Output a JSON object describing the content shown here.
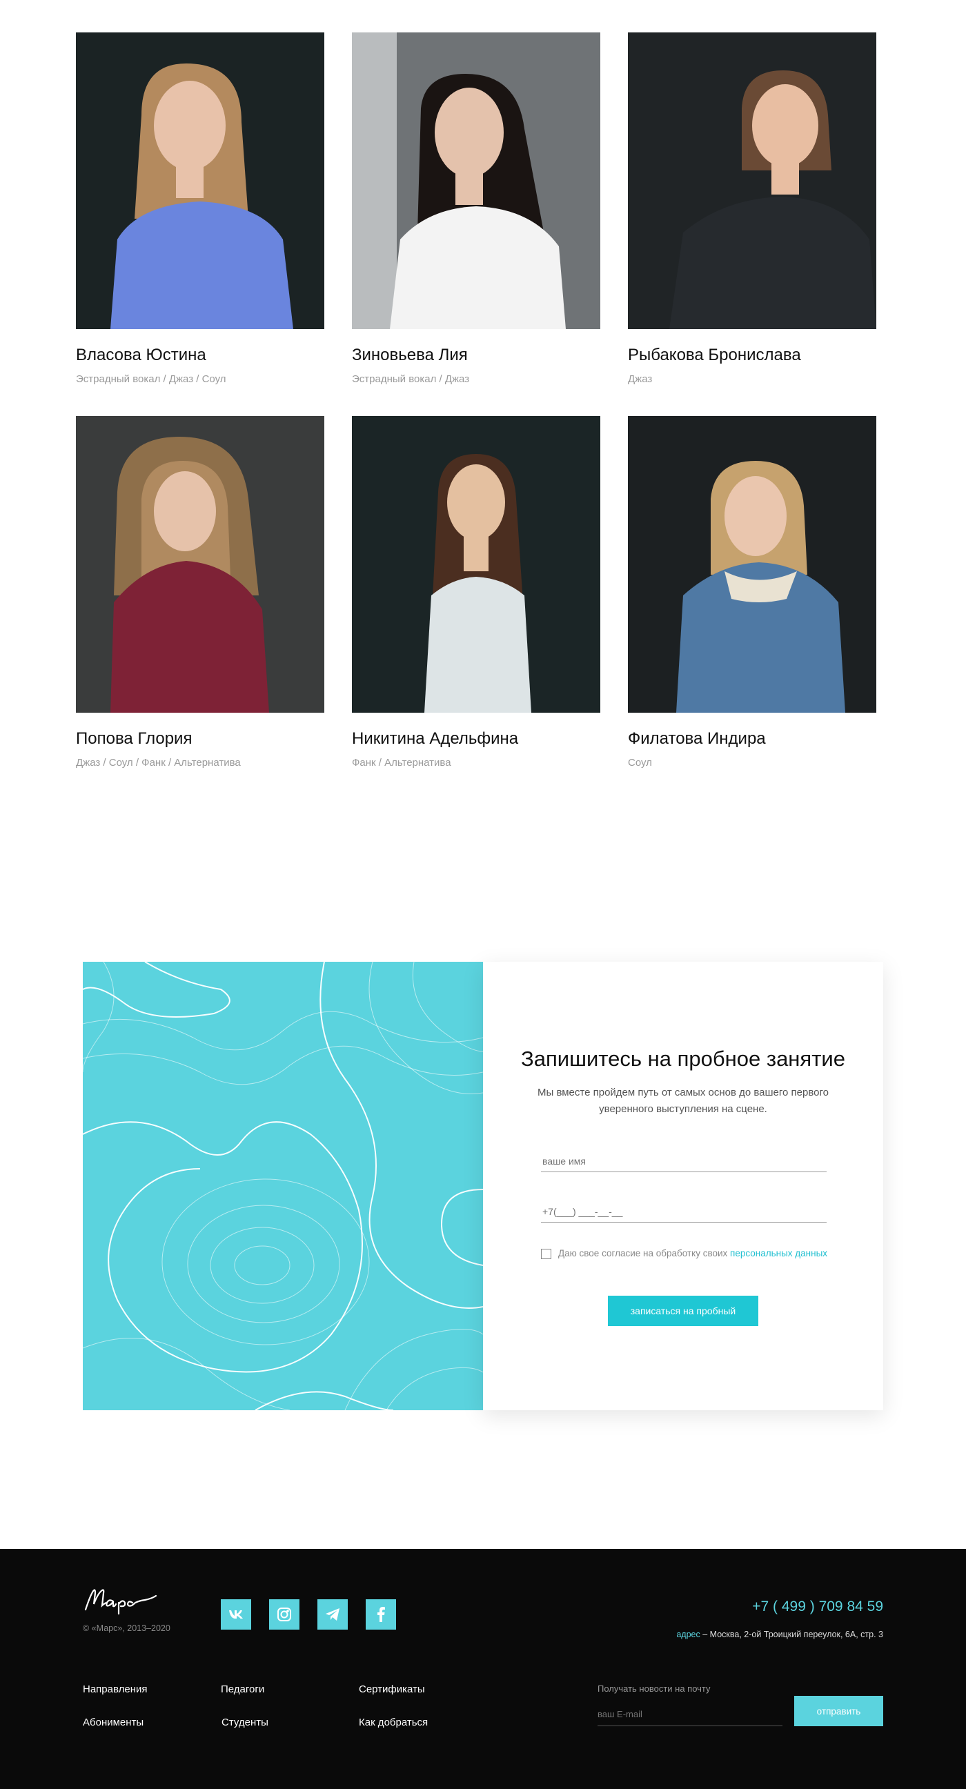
{
  "teachers": [
    {
      "name": "Власова Юстина",
      "genres": "Эстрадный вокал / Джаз / Соул",
      "bg": "#1b2324",
      "hair": "#b48a5e",
      "top": "#6a85de",
      "skin": "#e8c2aa"
    },
    {
      "name": "Зиновьева Лия",
      "genres": "Эстрадный вокал / Джаз",
      "bg": "#6f7376",
      "hair": "#1a1412",
      "top": "#f3f3f3",
      "skin": "#e4c2ac"
    },
    {
      "name": "Рыбакова Бронислава",
      "genres": "Джаз",
      "bg": "#202426",
      "hair": "#6a4a35",
      "top": "#262a2e",
      "skin": "#e8bea2"
    },
    {
      "name": "Попова Глория",
      "genres": "Джаз / Соул / Фанк / Альтернатива",
      "bg": "#3a3c3c",
      "hair": "#b08a60",
      "top": "#7e2236",
      "skin": "#e6c2aa"
    },
    {
      "name": "Никитина Адельфина",
      "genres": "Фанк / Альтернатива",
      "bg": "#1b2526",
      "hair": "#4b2e20",
      "top": "#dde4e6",
      "skin": "#e4c0a0"
    },
    {
      "name": "Филатова Индира",
      "genres": "Соул",
      "bg": "#1c2022",
      "hair": "#c6a26e",
      "top": "#4f79a4",
      "skin": "#eac6ae"
    }
  ],
  "signup": {
    "title": "Запишитесь на пробное занятие",
    "description": "Мы вместе пройдем путь от самых основ до вашего первого уверенного выступления на сцене.",
    "name_placeholder": "ваше имя",
    "phone_placeholder": "+7(___) ___-__-__",
    "consent_text": "Даю свое согласие на обработку своих ",
    "consent_link": "персональных данных",
    "submit_label": "записаться на пробный",
    "pattern_color": "#5bd3de",
    "accent_color": "#1fc7d4"
  },
  "footer": {
    "logo": "Марс",
    "copyright": "© «Марс», 2013–2020",
    "social": [
      "vk-icon",
      "instagram-icon",
      "telegram-icon",
      "facebook-icon"
    ],
    "phone": "+7 ( 499 ) 709 84 59",
    "address_label": "адрес",
    "address_text": " – Москва, 2-ой Троицкий переулок, 6А, стр. 3",
    "links": {
      "col1": [
        "Направления",
        "Абонименты"
      ],
      "col2": [
        "Педагоги",
        "Студенты"
      ],
      "col3": [
        "Сертификаты",
        "Как добраться"
      ]
    },
    "news_label": "Получать новости на почту",
    "email_placeholder": "ваш E-mail",
    "send_label": "отправить"
  }
}
